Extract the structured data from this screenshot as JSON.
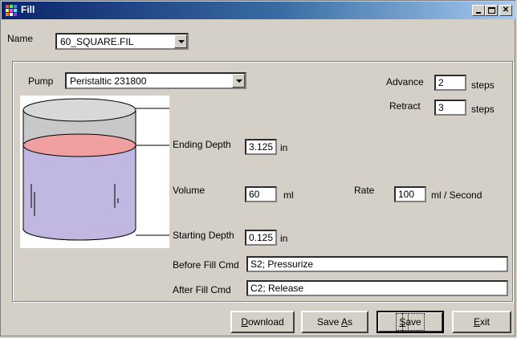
{
  "window": {
    "title": "Fill"
  },
  "name": {
    "label": "Name",
    "value": "60_SQUARE.FIL"
  },
  "pump": {
    "label": "Pump",
    "value": "Peristaltic 231800"
  },
  "advance": {
    "label": "Advance",
    "value": "2",
    "unit": "steps"
  },
  "retract": {
    "label": "Retract",
    "value": "3",
    "unit": "steps"
  },
  "ending_depth": {
    "label": "Ending Depth",
    "value": "3.125",
    "unit": "in"
  },
  "volume": {
    "label": "Volume",
    "value": "60",
    "unit": "ml"
  },
  "rate": {
    "label": "Rate",
    "value": "100",
    "unit": "ml / Second"
  },
  "starting_depth": {
    "label": "Starting Depth",
    "value": "0.125",
    "unit": "in"
  },
  "before_fill": {
    "label": "Before Fill Cmd",
    "value": "S2; Pressurize"
  },
  "after_fill": {
    "label": "After Fill Cmd",
    "value": "C2; Release"
  },
  "buttons": {
    "download": {
      "first": "D",
      "rest": "ownload"
    },
    "save_as": {
      "pre": "Save ",
      "key": "A",
      "post": "s"
    },
    "save": {
      "first": "S",
      "rest": "ave"
    },
    "exit": {
      "first": "E",
      "rest": "xit"
    }
  },
  "colors": {
    "liquid": "#c0b8e0",
    "liquid_top": "#f0a0a0",
    "titlebar": "#0a246a"
  }
}
